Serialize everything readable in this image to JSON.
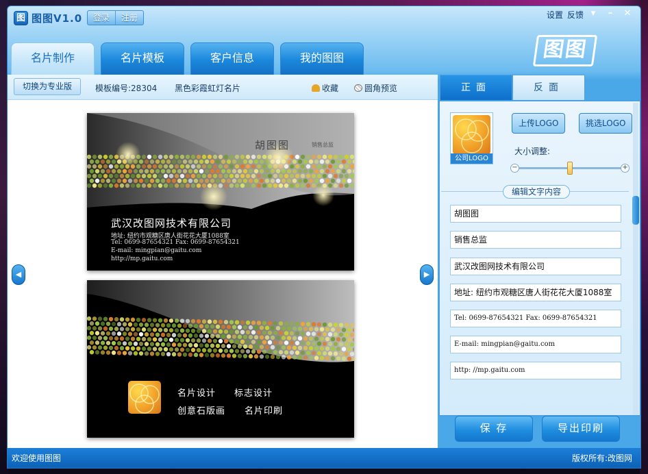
{
  "window": {
    "app_logo_glyph": "图",
    "app_title": "图图V1.0",
    "login": "登录",
    "register": "注册",
    "settings": "设置",
    "feedback": "反馈",
    "brand_mark": "图图"
  },
  "tabs": [
    {
      "label": "名片制作",
      "active": true
    },
    {
      "label": "名片模板",
      "active": false
    },
    {
      "label": "客户信息",
      "active": false
    },
    {
      "label": "我的图图",
      "active": false
    }
  ],
  "toolbar": {
    "pro_button": "切换为专业版",
    "template_no": "模板编号:28304",
    "template_name": "黑色彩霞虹灯名片",
    "favorite": "收藏",
    "rounded_preview": "圆角预览"
  },
  "card_front": {
    "name": "胡图图",
    "role": "销售总监",
    "company": "武汉改图网技术有限公司",
    "address": "地址: 纽约市观糖区唐人街花花大厦1088室",
    "phone": "Tel: 0699-87654321  Fax: 0699-87654321",
    "email": "E-mail: mingpian@gaitu.com",
    "web": "http://mp.gaitu.com"
  },
  "card_back": {
    "services": [
      "名片设计",
      "标志设计",
      "创意石版画",
      "名片印刷"
    ]
  },
  "side_tabs": [
    {
      "label": "正面",
      "active": true
    },
    {
      "label": "反面",
      "active": false
    }
  ],
  "side_panel": {
    "logo_caption": "公司LOGO",
    "upload_logo": "上传LOGO",
    "pick_logo": "挑选LOGO",
    "size_adjust": "大小调整:",
    "size_level": 0.5,
    "edit_text_label": "编辑文字内容",
    "fields": [
      "胡图图",
      "销售总监",
      "武汉改图网技术有限公司",
      "地址: 纽约市观糖区唐人街花花大厦1088室",
      "Tel: 0699-87654321   Fax: 0699-87654321",
      "E-mail: mingpian@gaitu.com",
      "http: //mp.gaitu.com"
    ],
    "save": "保 存",
    "export_print": "导出印刷"
  },
  "status": {
    "welcome": "欢迎使用图图",
    "copyright": "版权所有:改图网"
  },
  "colors": {
    "primary_blue": "#1a87dc",
    "card_black": "#000000",
    "logo_gold": "#f2a22a"
  }
}
